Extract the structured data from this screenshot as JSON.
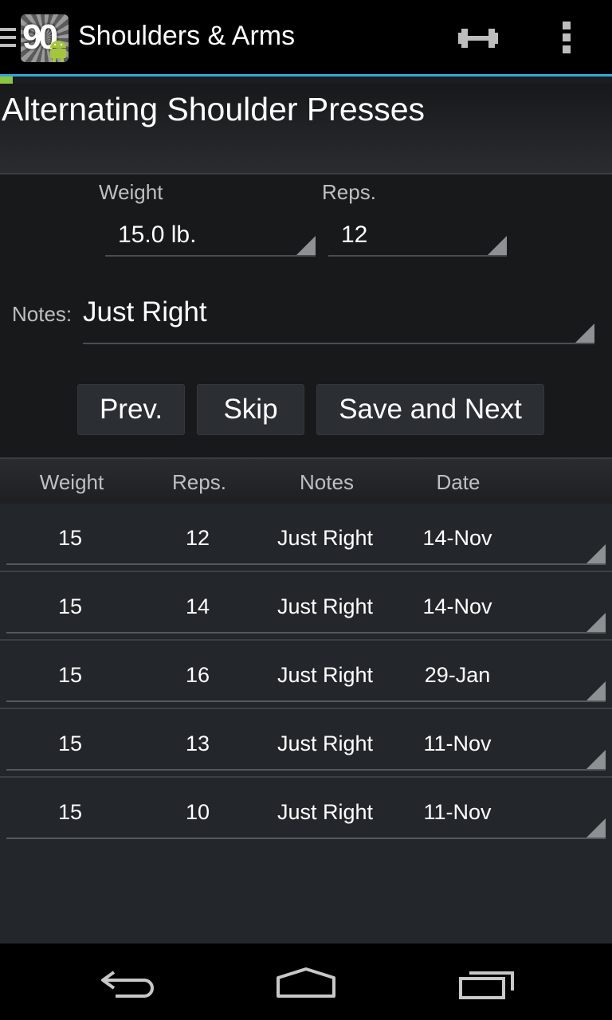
{
  "action_bar": {
    "app_icon_text": "90",
    "title": "Shoulders & Arms",
    "icons": [
      "drawer-icon",
      "dumbbell-icon",
      "overflow-menu-icon"
    ]
  },
  "exercise": {
    "title": "Alternating Shoulder Presses"
  },
  "form": {
    "weight_label": "Weight",
    "weight_value": "15.0 lb.",
    "reps_label": "Reps.",
    "reps_value": "12",
    "notes_label": "Notes:",
    "notes_value": "Just Right"
  },
  "buttons": {
    "prev": "Prev.",
    "skip": "Skip",
    "save_next": "Save and Next"
  },
  "history": {
    "headers": [
      "Weight",
      "Reps.",
      "Notes",
      "Date"
    ],
    "rows": [
      {
        "weight": "15",
        "reps": "12",
        "notes": "Just Right",
        "date": "14-Nov"
      },
      {
        "weight": "15",
        "reps": "14",
        "notes": "Just Right",
        "date": "14-Nov"
      },
      {
        "weight": "15",
        "reps": "16",
        "notes": "Just Right",
        "date": "29-Jan"
      },
      {
        "weight": "15",
        "reps": "13",
        "notes": "Just Right",
        "date": "11-Nov"
      },
      {
        "weight": "15",
        "reps": "10",
        "notes": "Just Right",
        "date": "11-Nov"
      }
    ]
  },
  "colors": {
    "accent": "#33a8d8",
    "progress": "#8cc63f"
  }
}
